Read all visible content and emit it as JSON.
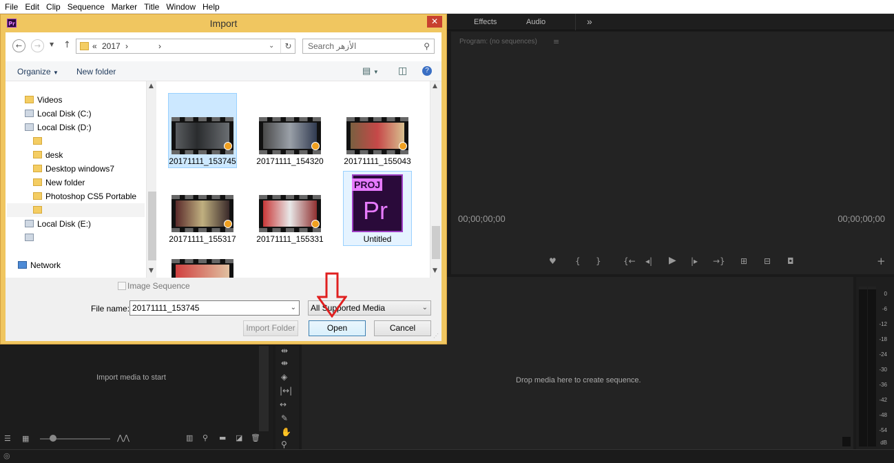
{
  "menu": [
    "File",
    "Edit",
    "Clip",
    "Sequence",
    "Marker",
    "Title",
    "Window",
    "Help"
  ],
  "panel_tabs": {
    "effects": "Effects",
    "audio": "Audio",
    "overflow": "»"
  },
  "program": {
    "title": "Program: (no sequences)",
    "menu_icon": "≡",
    "tc_left": "00;00;00;00",
    "tc_right": "00;00;00;00"
  },
  "project": {
    "hint": "Import media to start"
  },
  "timeline": {
    "hint": "Drop media here to create sequence."
  },
  "meter_labels": [
    "0",
    "-6",
    "-12",
    "-18",
    "-24",
    "-30",
    "-36",
    "-42",
    "-48",
    "-54",
    "dB"
  ],
  "dialog": {
    "title": "Import",
    "app_badge": "Pr",
    "close": "✕",
    "address": {
      "chevrons": "«",
      "segment": "2017",
      "sep": "›"
    },
    "search_placeholder": "Search الأزهر",
    "toolbar": {
      "organize": "Organize",
      "new_folder": "New folder"
    },
    "nav": [
      {
        "label": "Videos",
        "icon": "videos-folder-icon"
      },
      {
        "label": "Local Disk (C:)",
        "icon": "drive-icon"
      },
      {
        "label": "Local Disk (D:)",
        "icon": "drive-icon"
      },
      {
        "label": "",
        "icon": "folder-icon"
      },
      {
        "label": "desk",
        "icon": "folder-icon"
      },
      {
        "label": "Desktop windows7",
        "icon": "folder-icon"
      },
      {
        "label": "New folder",
        "icon": "folder-icon"
      },
      {
        "label": "Photoshop CS5 Portable",
        "icon": "folder-icon"
      },
      {
        "label": "",
        "icon": "folder-icon"
      },
      {
        "label": "Local Disk (E:)",
        "icon": "drive-icon"
      },
      {
        "label": "",
        "icon": "drive-icon"
      },
      {
        "label": "Network",
        "icon": "network-icon"
      }
    ],
    "files": [
      {
        "name": "20171111_153745",
        "selected": true
      },
      {
        "name": "20171111_154320",
        "selected": false
      },
      {
        "name": "20171111_155043",
        "selected": false
      },
      {
        "name": "20171111_155317",
        "selected": false
      },
      {
        "name": "20171111_155331",
        "selected": false
      },
      {
        "name": "Untitled",
        "selected": true,
        "type": "project"
      }
    ],
    "project_icon": {
      "top": "PROJ",
      "main": "Pr"
    },
    "image_sequence": "Image Sequence",
    "file_name_label": "File name:",
    "file_name_value": "20171111_153745",
    "filter_value": "All Supported Media",
    "import_folder": "Import Folder",
    "open": "Open",
    "cancel": "Cancel"
  }
}
